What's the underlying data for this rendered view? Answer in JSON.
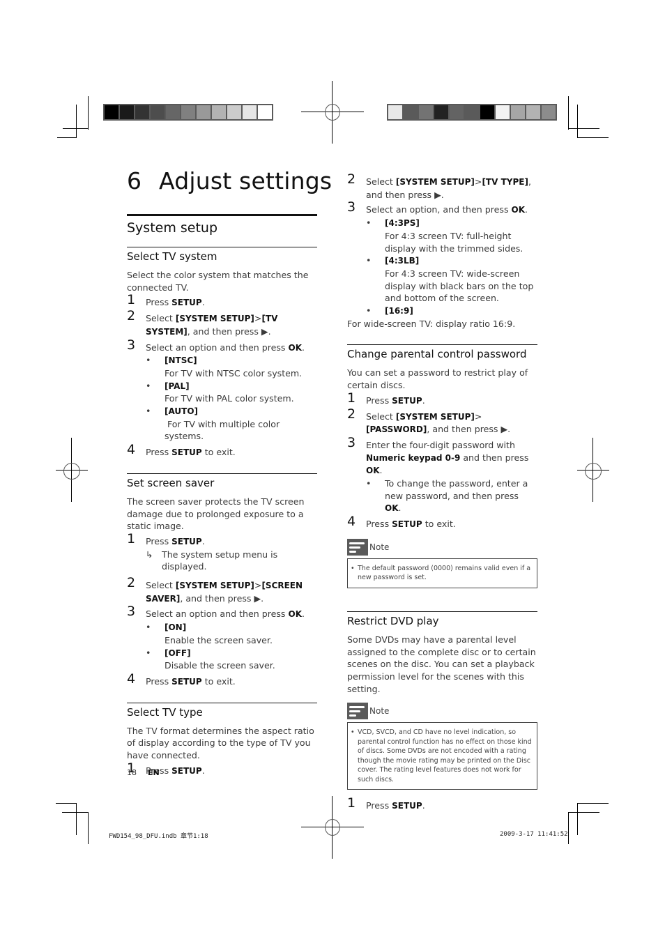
{
  "print_marks": {
    "swatches_left": [
      "#000000",
      "#1a1a1a",
      "#333333",
      "#4d4d4d",
      "#666666",
      "#808080",
      "#999999",
      "#b3b3b3",
      "#cccccc",
      "#e6e6e6",
      "#ffffff"
    ],
    "swatches_right": [
      "#e8e8e8",
      "#5a5a5a",
      "#737373",
      "#222222",
      "#636363",
      "#5a5a5a",
      "#000000",
      "#f2f2f2",
      "#a6a6a6",
      "#b3b3b3",
      "#8c8c8c"
    ],
    "slug_left": "FWD154_98_DFU.indb   章节1:18",
    "slug_right": "2009-3-17   11:41:52"
  },
  "chapter": {
    "number": "6",
    "title": "Adjust settings"
  },
  "section": {
    "title": "System setup"
  },
  "left_column": {
    "select_tv_system": {
      "heading": "Select TV system",
      "intro": "Select the color system that matches the connected TV.",
      "steps": [
        {
          "n": "1",
          "pre": "Press ",
          "bold": "SETUP",
          "post": "."
        },
        {
          "n": "2",
          "pre": "Select ",
          "bold": "[SYSTEM SETUP]",
          "mid": ">",
          "bold2": "[TV SYSTEM]",
          "post": ", and then press ▶."
        },
        {
          "n": "3",
          "pre": "Select an option and then press ",
          "bold": "OK",
          "post": "."
        },
        {
          "n": "4",
          "pre": "Press ",
          "bold": "SETUP",
          "post": " to exit."
        }
      ],
      "options": [
        {
          "name": "[NTSC]",
          "desc": "For TV with NTSC color system."
        },
        {
          "name": "[PAL]",
          "desc": "For TV with PAL color system."
        },
        {
          "name": "[AUTO]",
          "desc": "For TV with multiple color systems."
        }
      ]
    },
    "set_screen_saver": {
      "heading": "Set screen saver",
      "intro": "The screen saver protects the TV screen damage due to prolonged exposure to a static image.",
      "steps": [
        {
          "n": "1",
          "pre": "Press ",
          "bold": "SETUP",
          "post": "."
        },
        {
          "n": "2",
          "pre": "Select ",
          "bold": "[SYSTEM SETUP]",
          "mid": ">",
          "bold2": "[SCREEN SAVER]",
          "post": ", and then press ▶."
        },
        {
          "n": "3",
          "pre": "Select an option and then press ",
          "bold": "OK",
          "post": "."
        },
        {
          "n": "4",
          "pre": "Press ",
          "bold": "SETUP",
          "post": " to exit."
        }
      ],
      "result": "The system setup menu is displayed.",
      "options": [
        {
          "name": "[ON]",
          "desc": "Enable the screen saver."
        },
        {
          "name": "[OFF]",
          "desc": "Disable the screen saver."
        }
      ]
    },
    "select_tv_type": {
      "heading": "Select TV type",
      "intro": "The TV format determines the aspect ratio of display according to the type of TV you have connected.",
      "steps": [
        {
          "n": "1",
          "pre": "Press ",
          "bold": "SETUP",
          "post": "."
        }
      ]
    }
  },
  "right_column": {
    "tv_type_cont": {
      "steps": [
        {
          "n": "2",
          "pre": "Select ",
          "bold": "[SYSTEM SETUP]",
          "mid": ">",
          "bold2": "[TV TYPE]",
          "post": ", and then press ▶."
        },
        {
          "n": "3",
          "pre": "Select an option, and then press ",
          "bold": "OK",
          "post": "."
        }
      ],
      "options": [
        {
          "name": "[4:3PS]",
          "desc": "For 4:3 screen TV: full-height display with the trimmed sides."
        },
        {
          "name": "[4:3LB]",
          "desc": "For 4:3 screen TV: wide-screen display with black bars on the top and bottom of the screen."
        },
        {
          "name": "[16:9]",
          "desc": ""
        }
      ],
      "trailing": "For wide-screen TV: display ratio 16:9."
    },
    "change_password": {
      "heading": "Change parental control password",
      "intro": "You can set a password to restrict play of certain discs.",
      "steps": [
        {
          "n": "1",
          "pre": "Press ",
          "bold": "SETUP",
          "post": "."
        },
        {
          "n": "2",
          "pre": "Select ",
          "bold": "[SYSTEM SETUP]",
          "mid": ">",
          "bold2": "[PASSWORD]",
          "post": ", and then press ▶."
        },
        {
          "n": "3",
          "pre": "Enter the four-digit password with ",
          "bold": "Numeric keypad 0-9",
          "post": " and then press ",
          "bold3": "OK",
          "post2": "."
        },
        {
          "n": "4",
          "pre": "Press ",
          "bold": "SETUP",
          "post": " to exit."
        }
      ],
      "sub_bullet": {
        "pre": "To change the password, enter a new password, and then press ",
        "bold": "OK",
        "post": "."
      },
      "note_label": "Note",
      "note_text": "The default password (0000) remains valid even if a new password is set."
    },
    "restrict_dvd": {
      "heading": "Restrict DVD play",
      "intro": "Some DVDs may have a parental level assigned to the complete disc or to certain scenes on the disc. You can set a playback permission level for the scenes with this setting.",
      "note_label": "Note",
      "note_text": "VCD, SVCD, and CD have no level indication, so parental control function has no effect on those kind of discs. Some DVDs are not encoded with a rating though the movie rating may be printed on the Disc cover. The rating level features does not work for such discs.",
      "steps": [
        {
          "n": "1",
          "pre": "Press ",
          "bold": "SETUP",
          "post": "."
        }
      ]
    }
  },
  "footer": {
    "page_number": "18",
    "language": "EN"
  },
  "glyphs": {
    "bullet": "•",
    "result_arrow": "↳"
  }
}
